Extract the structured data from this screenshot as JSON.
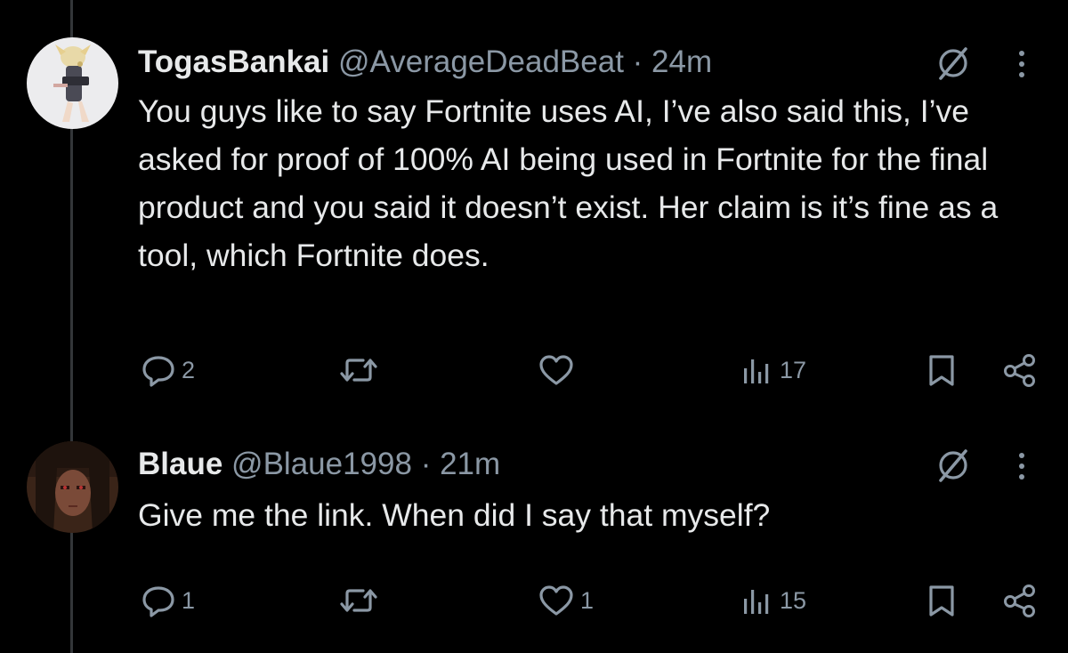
{
  "tweets": [
    {
      "display_name": "TogasBankai",
      "handle": "@AverageDeadBeat",
      "separator": "·",
      "time": "24m",
      "text": "You guys like to say Fortnite uses AI, I’ve also said this, I’ve asked for proof of 100% AI being used in Fortnite for the final product and you said it doesn’t exist. Her claim is it’s fine as a tool, which Fortnite does.",
      "reply_count": "2",
      "retweet_count": "",
      "like_count": "",
      "view_count": "17"
    },
    {
      "display_name": "Blaue",
      "handle": "@Blaue1998",
      "separator": "·",
      "time": "21m",
      "text": "Give me the link. When did I say that myself?",
      "reply_count": "1",
      "retweet_count": "",
      "like_count": "1",
      "view_count": "15"
    }
  ],
  "icons": {
    "avatar_1": "anime-character-avatar",
    "avatar_2": "anime-character-avatar",
    "grok": "grok-icon",
    "more": "more-options-icon",
    "reply": "reply-icon",
    "retweet": "retweet-icon",
    "like": "like-heart-icon",
    "views": "views-bar-chart-icon",
    "bookmark": "bookmark-icon",
    "share": "share-icon"
  },
  "colors": {
    "background": "#000000",
    "text_primary": "#e7e9ea",
    "text_secondary": "#8b98a5",
    "thread_line": "#333639"
  }
}
